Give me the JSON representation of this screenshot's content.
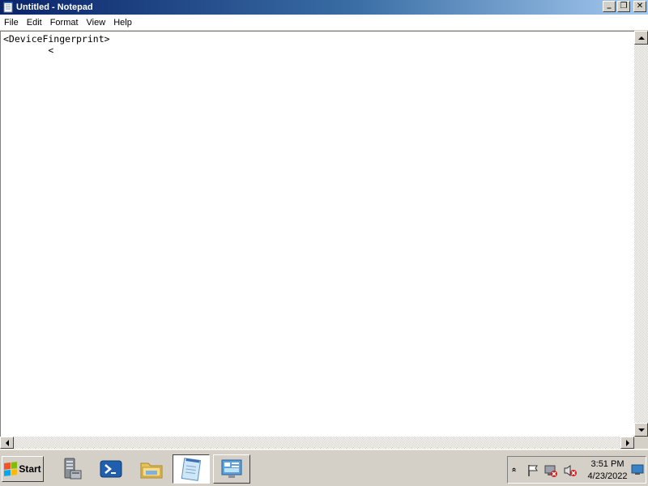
{
  "window": {
    "title": "Untitled - Notepad",
    "minimize": "_",
    "restore": "❐",
    "close": "✕"
  },
  "menu": {
    "file": "File",
    "edit": "Edit",
    "format": "Format",
    "view": "View",
    "help": "Help"
  },
  "editor": {
    "content": "<DeviceFingerprint>\n        <"
  },
  "taskbar": {
    "start_label": "Start",
    "apps": [
      "server-manager-icon",
      "powershell-icon",
      "file-explorer-icon",
      "notepad-icon",
      "control-panel-icon"
    ],
    "active_app": "notepad-icon"
  },
  "tray": {
    "time": "3:51 PM",
    "date": "4/23/2022",
    "chevron": "»"
  },
  "colors": {
    "titlebar_start": "#0a246a",
    "titlebar_end": "#a6caf0",
    "chrome": "#d4d0c8"
  }
}
